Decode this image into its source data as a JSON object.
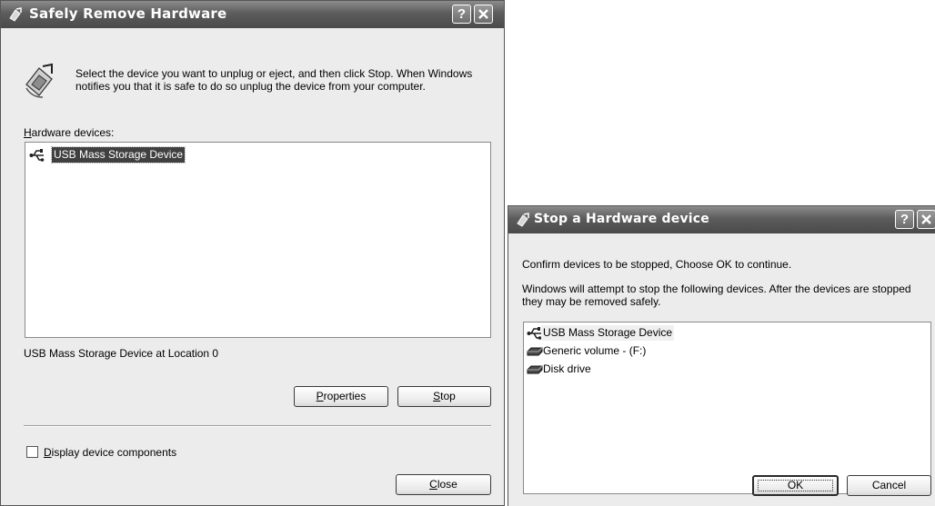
{
  "safely_remove": {
    "title": "Safely Remove Hardware",
    "instruction": "Select the device you want to unplug or eject, and then click Stop. When Windows notifies you that it is safe to do so unplug the device from your computer.",
    "devices_label_accel": "H",
    "devices_label_rest": "ardware devices:",
    "devices": [
      {
        "label": "USB Mass Storage Device",
        "icon": "usb-icon",
        "selected": true
      }
    ],
    "status_text": "USB Mass Storage Device at Location 0",
    "properties_accel": "P",
    "properties_rest": "roperties",
    "stop_accel": "S",
    "stop_rest": "top",
    "display_components_accel": "D",
    "display_components_rest": "isplay device components",
    "display_components_checked": false,
    "close_accel": "C",
    "close_rest": "lose",
    "help_glyph": "?"
  },
  "stop_device": {
    "title": "Stop a Hardware device",
    "confirm_text": "Confirm devices to be stopped, Choose OK to continue.",
    "info_text": "Windows will attempt to stop the following devices. After the devices are stopped they may be removed safely.",
    "devices": [
      {
        "label": "USB Mass Storage Device",
        "icon": "usb-icon"
      },
      {
        "label": "Generic volume - (F:)",
        "icon": "drive-icon"
      },
      {
        "label": "Disk drive",
        "icon": "drive-icon"
      }
    ],
    "ok_label": "OK",
    "cancel_label": "Cancel",
    "help_glyph": "?"
  },
  "colors": {
    "titlebar": "#5c5c5c",
    "dialog_bg": "#ececec",
    "selection": "#404040"
  }
}
